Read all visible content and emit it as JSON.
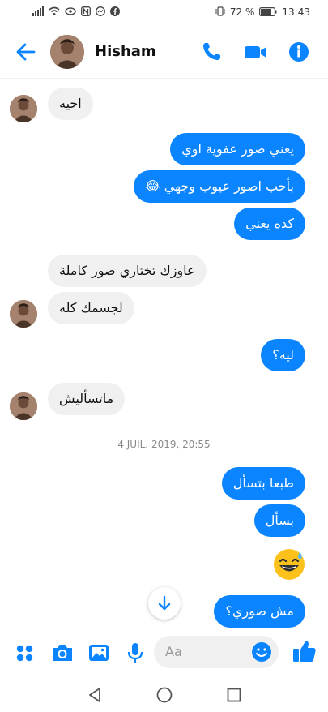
{
  "status_bar": {
    "battery": "72 %",
    "time": "13:43"
  },
  "header": {
    "contact_name": "Hisham"
  },
  "messages": [
    {
      "text": "احيه"
    },
    {
      "text": "يعني صور عفوية اوي"
    },
    {
      "text": "بأحب اصور عيوب وجهي 😂"
    },
    {
      "text": "كده يعني"
    },
    {
      "text": "عاوزك تختاري صور كاملة"
    },
    {
      "text": "لجسمك كله"
    },
    {
      "text": "ليه؟"
    },
    {
      "text": "ماتسأليش"
    },
    {
      "text": "طبعا بتسأل"
    },
    {
      "text": "بسأل"
    },
    {
      "text": "مش صوري؟"
    }
  ],
  "date_separator": "4 JUIL. 2019, 20:55",
  "composer": {
    "placeholder": "Aa"
  },
  "colors": {
    "accent": "#0a84ff",
    "incoming_bubble": "#f0f0f0"
  },
  "icons": [
    "back-arrow-icon",
    "phone-icon",
    "video-icon",
    "info-icon",
    "apps-icon",
    "camera-icon",
    "image-icon",
    "microphone-icon",
    "emoji-icon",
    "thumbs-up-icon",
    "scroll-down-arrow-icon"
  ]
}
